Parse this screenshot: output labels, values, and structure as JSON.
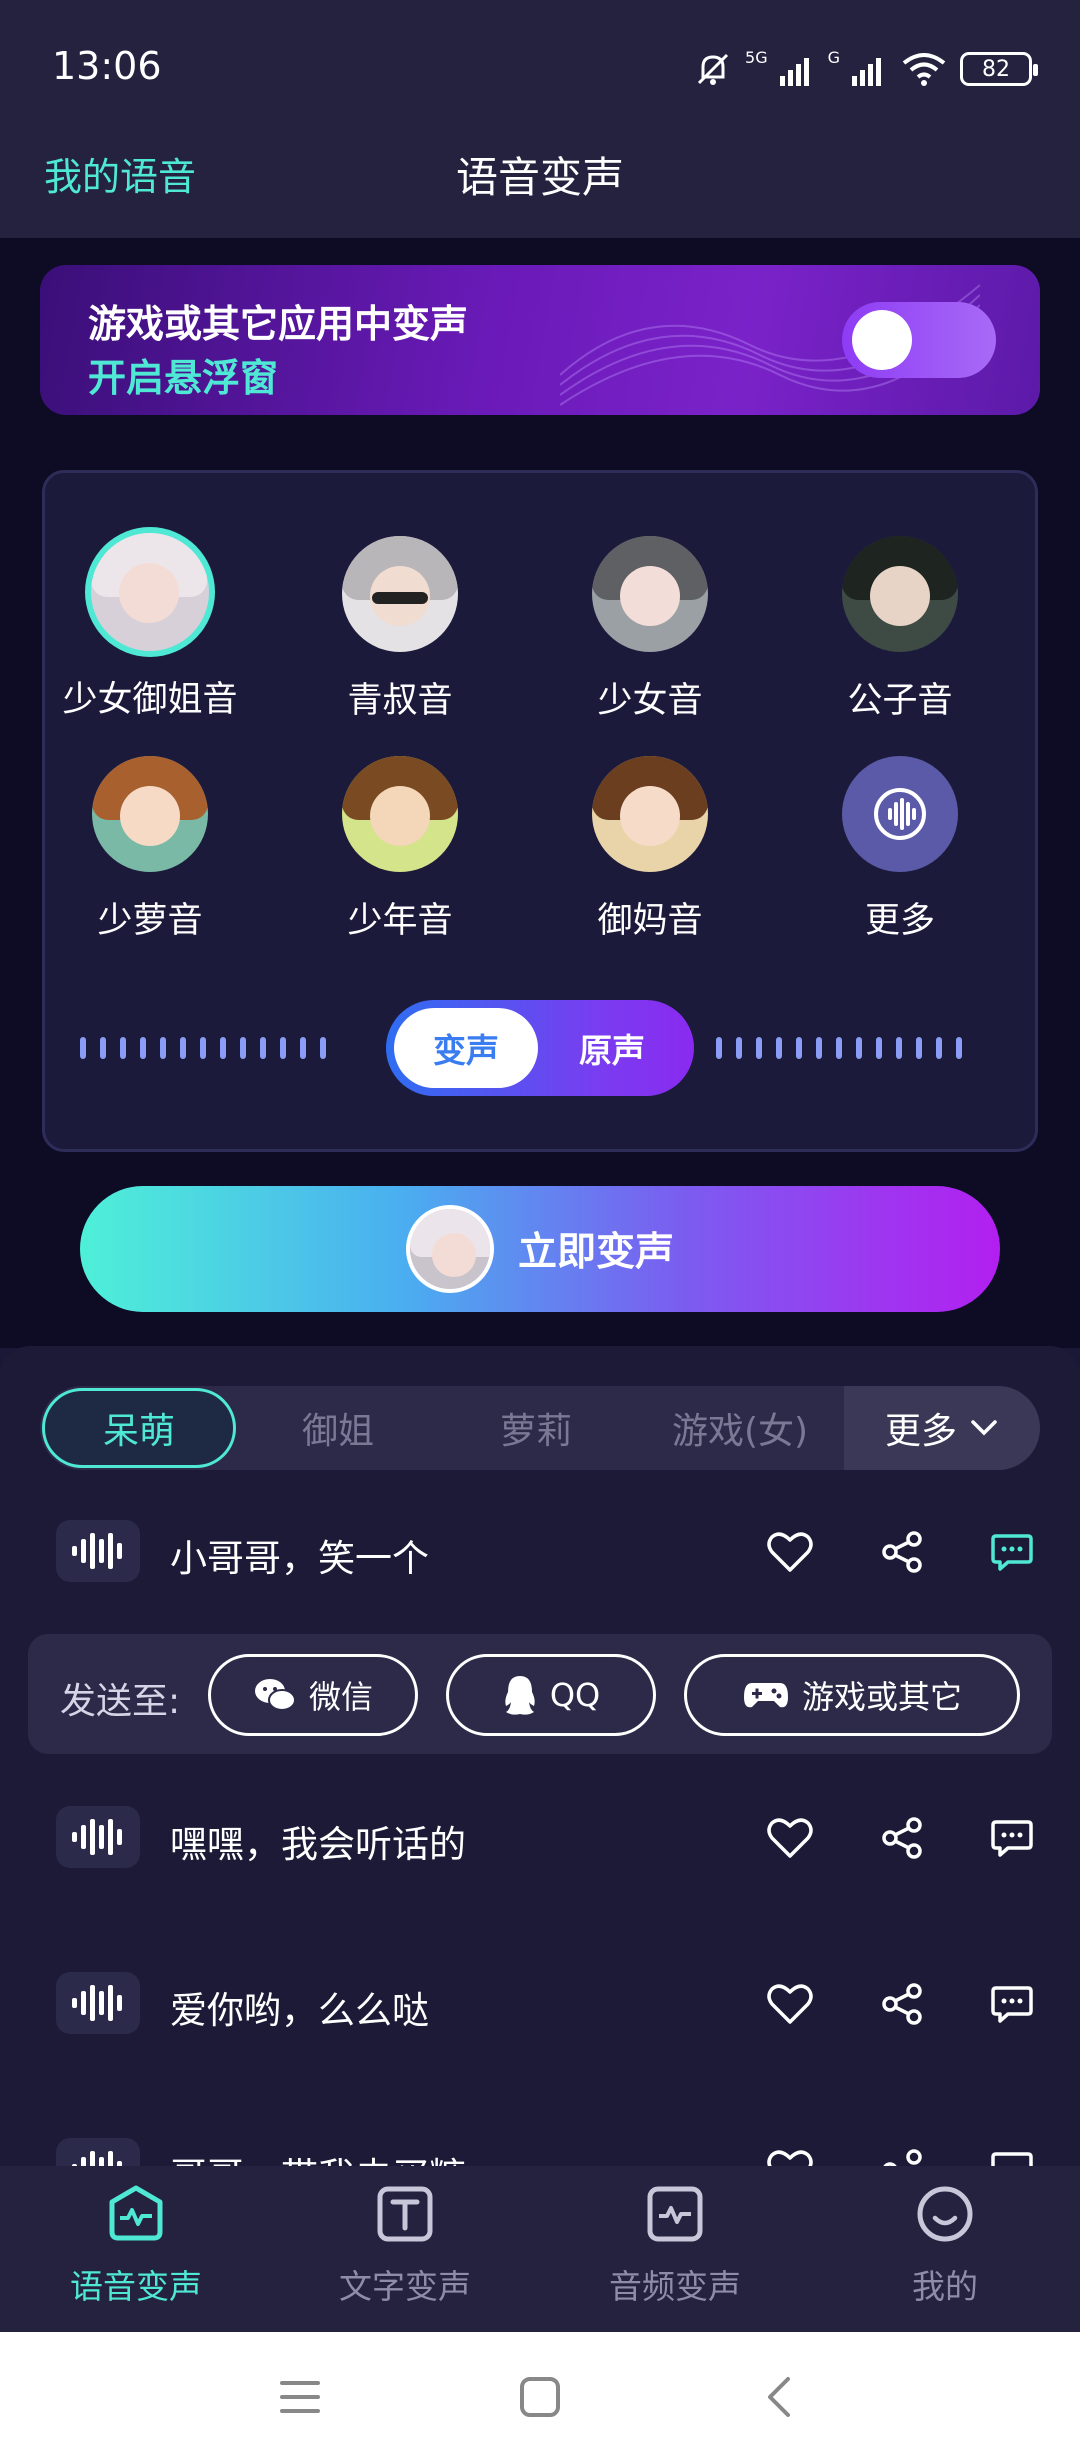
{
  "status_bar": {
    "time": "13:06",
    "battery": "82",
    "signal_1": "5G",
    "signal_2": "G"
  },
  "header": {
    "left_link": "我的语音",
    "title": "语音变声"
  },
  "float_banner": {
    "line1": "游戏或其它应用中变声",
    "line2": "开启悬浮窗",
    "toggle_on": false
  },
  "voices": [
    {
      "label": "少女御姐音",
      "selected": true
    },
    {
      "label": "青叔音",
      "selected": false
    },
    {
      "label": "少女音",
      "selected": false
    },
    {
      "label": "公子音",
      "selected": false
    },
    {
      "label": "少萝音",
      "selected": false
    },
    {
      "label": "少年音",
      "selected": false
    },
    {
      "label": "御妈音",
      "selected": false
    },
    {
      "label": "更多",
      "selected": false
    }
  ],
  "mode_switch": {
    "changed": "变声",
    "original": "原声",
    "selected": "changed"
  },
  "start_button": {
    "label": "立即变声"
  },
  "category_tabs": {
    "items": [
      "呆萌",
      "御姐",
      "萝莉",
      "游戏(女)"
    ],
    "selected": "呆萌",
    "more": "更多"
  },
  "phrases": [
    {
      "text": "小哥哥，笑一个",
      "active": true
    },
    {
      "text": "嘿嘿，我会听话的",
      "active": false
    },
    {
      "text": "爱你哟，么么哒",
      "active": false
    },
    {
      "text": "哥哥，带我去买糖",
      "active": false
    }
  ],
  "send_bar": {
    "label": "发送至:",
    "targets": [
      "微信",
      "QQ",
      "游戏或其它"
    ]
  },
  "bottom_nav": {
    "items": [
      {
        "label": "语音变声",
        "icon": "voice-wave-icon",
        "active": true
      },
      {
        "label": "文字变声",
        "icon": "text-icon",
        "active": false
      },
      {
        "label": "音频变声",
        "icon": "audio-file-icon",
        "active": false
      },
      {
        "label": "我的",
        "icon": "smile-face-icon",
        "active": false
      }
    ]
  },
  "colors": {
    "accent": "#4ee8d4",
    "background": "#1a1836",
    "purple": "#8e3cf4"
  }
}
